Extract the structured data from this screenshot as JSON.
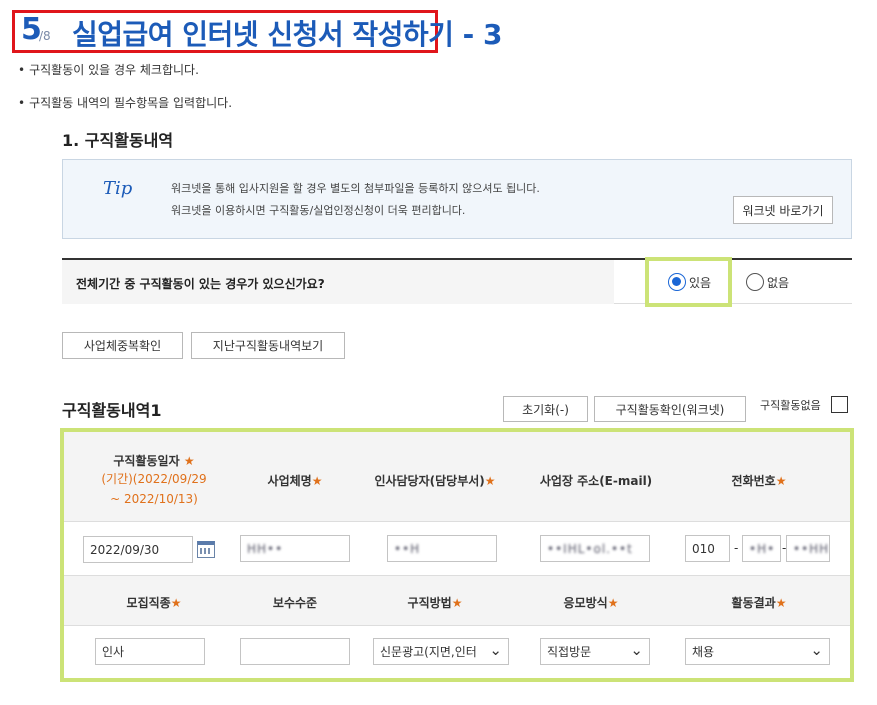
{
  "header": {
    "step_current": "5",
    "step_total": "/8",
    "title": "실업급여 인터넷 신청서 작성하기 - 3"
  },
  "bullets": [
    "구직활동이 있을 경우 체크합니다.",
    "구직활동 내역의 필수항목을 입력합니다."
  ],
  "section": {
    "title": "1. 구직활동내역"
  },
  "tip": {
    "label": "Tip",
    "line1": "워크넷을 통해 입사지원을 할 경우 별도의 첨부파일을 등록하지 않으셔도 됩니다.",
    "line2": "워크넷을 이용하시면 구직활동/실업인정신청이 더욱 편리합니다.",
    "button": "워크넷 바로가기"
  },
  "question": {
    "label": "전체기간 중 구직활동이 있는 경우가 있으신가요?",
    "yes": "있음",
    "no": "없음"
  },
  "buttons": {
    "dup_check": "사업체중복확인",
    "history": "지난구직활동내역보기",
    "reset": "초기화(-)",
    "confirm": "구직활동확인(워크넷)"
  },
  "activity": {
    "title": "구직활동내역1",
    "no_activity": "구직활동없음",
    "headers1": {
      "date": "구직활동일자",
      "period": "(기간)(2022/09/29",
      "period2": "~ 2022/10/13)",
      "company": "사업체명",
      "manager": "인사담당자(담당부서)",
      "email": "사업장 주소(E-mail)",
      "phone": "전화번호"
    },
    "row1": {
      "date": "2022/09/30",
      "company": "HH••",
      "manager": "••H",
      "email": "••IHL•ol.••t",
      "phone1": "010",
      "phone2": "•H•",
      "phone3": "••HH"
    },
    "headers2": {
      "job_type": "모집직종",
      "salary": "보수수준",
      "method": "구직방법",
      "apply": "응모방식",
      "result": "활동결과"
    },
    "row2": {
      "job_type": "인사",
      "salary": "",
      "method": "신문광고(지면,인터",
      "apply": "직접방문",
      "result": "채용"
    },
    "star": "★"
  }
}
